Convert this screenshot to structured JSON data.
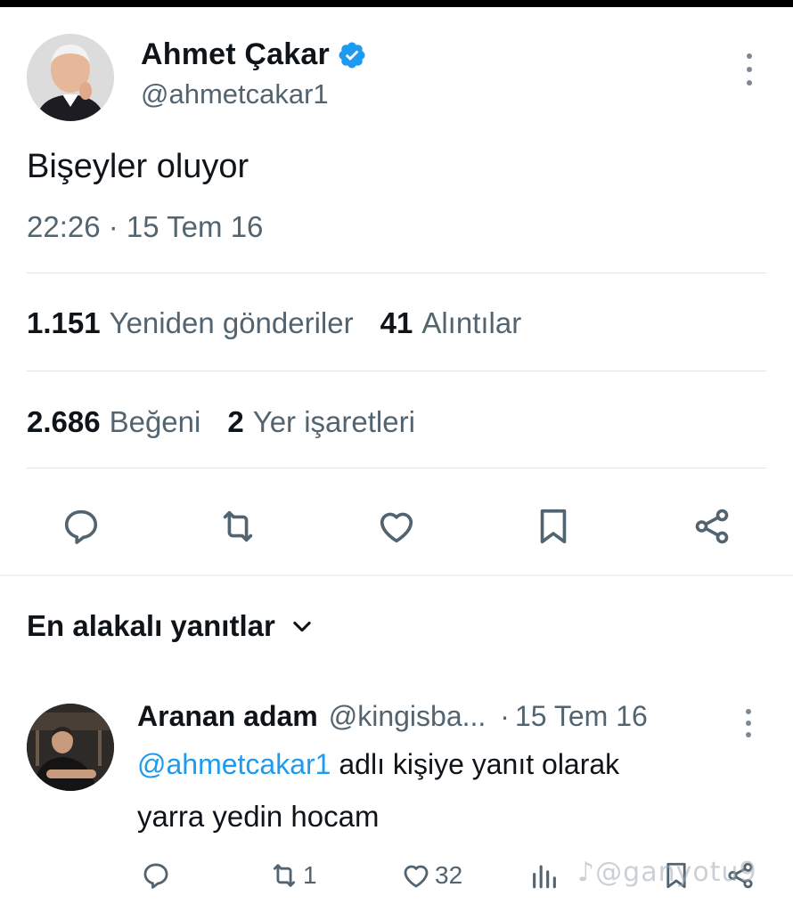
{
  "tweet": {
    "author_name": "Ahmet Çakar",
    "author_handle": "@ahmetcakar1",
    "verified": true,
    "text": "Bişeyler oluyor",
    "timestamp": "22:26 · 15 Tem 16",
    "stats": {
      "reposts_count": "1.151",
      "reposts_label": "Yeniden gönderiler",
      "quotes_count": "41",
      "quotes_label": "Alıntılar",
      "likes_count": "2.686",
      "likes_label": "Beğeni",
      "bookmarks_count": "2",
      "bookmarks_label": "Yer işaretleri"
    },
    "actions": [
      "reply-icon",
      "repost-icon",
      "like-icon",
      "bookmark-icon",
      "share-icon"
    ]
  },
  "replies_section": {
    "sort_label": "En alakalı yanıtlar"
  },
  "reply": {
    "author_name": "Aranan adam",
    "author_handle": "@kingisba...",
    "separator": "·",
    "date": "15 Tem 16",
    "reply_to_mention": "@ahmetcakar1",
    "reply_to_suffix": " adlı kişiye yanıt olarak",
    "text": "yarra yedin hocam",
    "repost_count": "1",
    "like_count": "32"
  },
  "watermark": "♪@ganyotu9",
  "colors": {
    "text_primary": "#0f1419",
    "text_secondary": "#536471",
    "accent": "#1d9bf0",
    "divider": "#e1e5e8"
  }
}
